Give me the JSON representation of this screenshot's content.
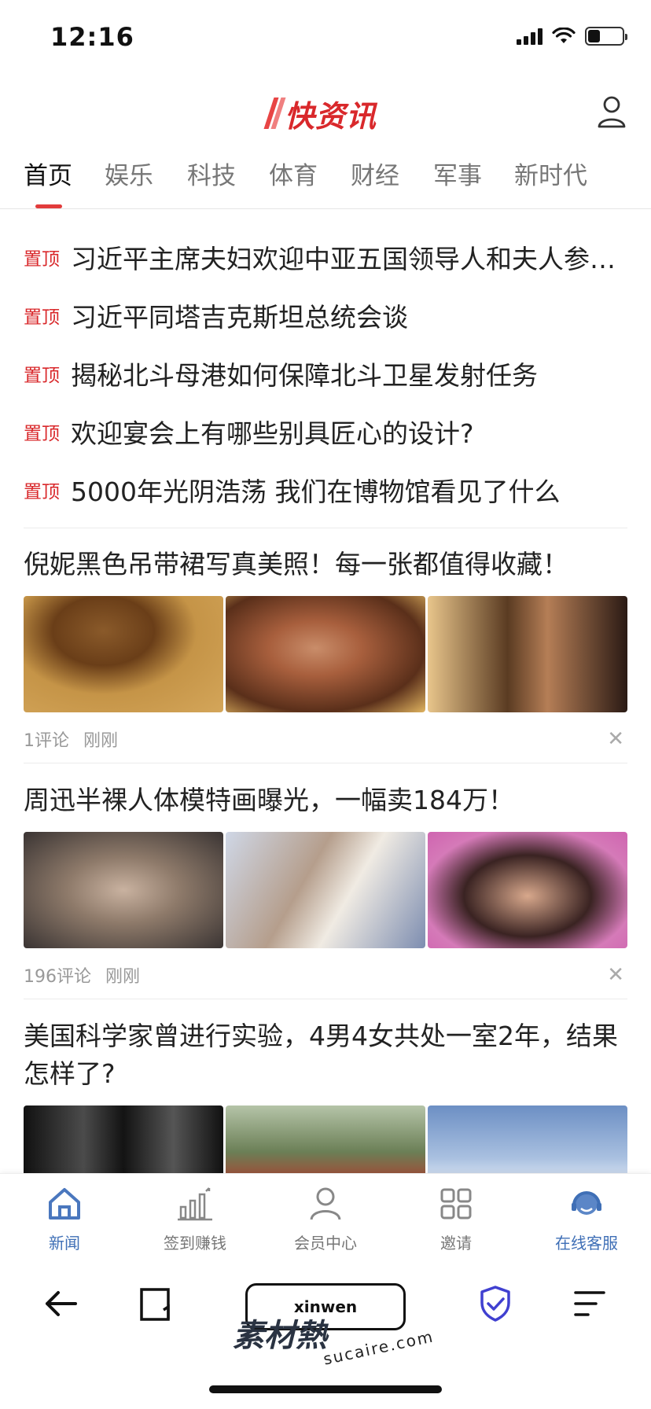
{
  "status": {
    "time": "12:16",
    "battery_level": 0.35
  },
  "header": {
    "logo": "快资讯"
  },
  "tabs": [
    "首页",
    "娱乐",
    "科技",
    "体育",
    "财经",
    "军事",
    "新时代"
  ],
  "pinned": {
    "tag": "置顶",
    "items": [
      "习近平主席夫妇欢迎中亚五国领导人和夫人参加中国－中亚峰会",
      "习近平同塔吉克斯坦总统会谈",
      "揭秘北斗母港如何保障北斗卫星发射任务",
      "欢迎宴会上有哪些别具匠心的设计?",
      "5000年光阴浩荡 我们在博物馆看见了什么"
    ]
  },
  "articles": [
    {
      "title": "倪妮黑色吊带裙写真美照！每一张都值得收藏！",
      "comments": "1评论",
      "time": "刚刚"
    },
    {
      "title": "周迅半裸人体模特画曝光，一幅卖184万！",
      "comments": "196评论",
      "time": "刚刚"
    },
    {
      "title": "美国科学家曾进行实验，4男4女共处一室2年，结果怎样了?"
    }
  ],
  "tabbar": [
    "新闻",
    "签到赚钱",
    "会员中心",
    "邀请",
    "在线客服"
  ],
  "browser": {
    "url": "xinwen",
    "watermark": "素材熱",
    "watermark_sub": "sucaire.com"
  },
  "colors": {
    "accent_red": "#d9282b",
    "tab_blue": "#3f6fb6"
  }
}
